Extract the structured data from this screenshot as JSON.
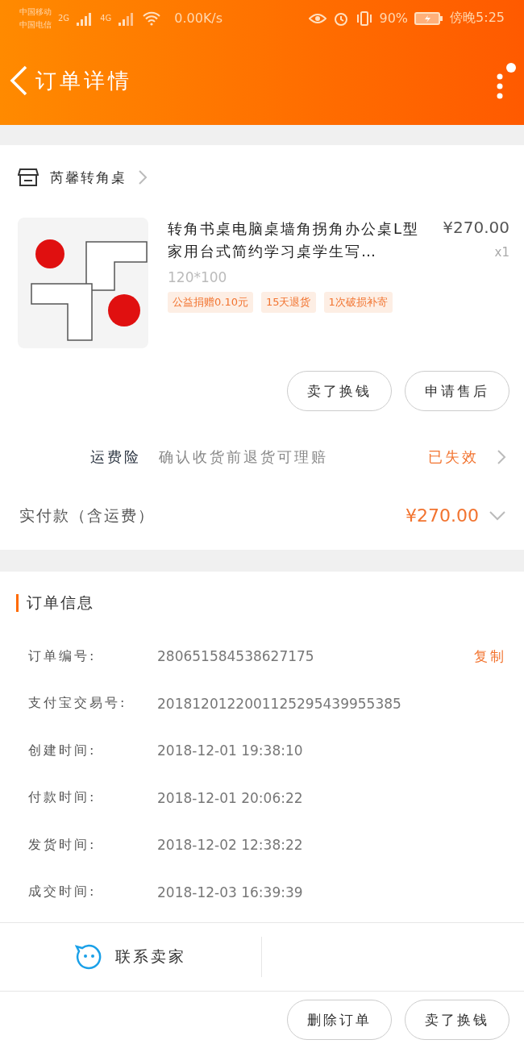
{
  "status_bar": {
    "carriers": [
      "中国移动",
      "中国电信"
    ],
    "networks": [
      "2G",
      "4G"
    ],
    "speed": "0.00K/s",
    "battery": "90%",
    "time": "傍晚5:25"
  },
  "header": {
    "title": "订单详情"
  },
  "shop": {
    "name": "芮馨转角桌"
  },
  "item": {
    "image": {
      "kind": "picture"
    },
    "title": "转角书桌电脑桌墙角拐角办公桌L型家用台式简约学习桌学生写…",
    "price": "¥270.00",
    "quantity": "x1",
    "spec": "120*100",
    "tags": [
      "公益捐赠0.10元",
      "15天退货",
      "1次破损补寄"
    ],
    "actions": [
      "卖了换钱",
      "申请售后"
    ]
  },
  "insurance": {
    "label": "运费险",
    "description": "确认收货前退货可理赔",
    "status": "已失效"
  },
  "total": {
    "label": "实付款（含运费）",
    "amount": "¥270.00",
    "expanded": false
  },
  "order_info": {
    "title": "订单信息",
    "copy": "复制",
    "rows": [
      {
        "label": "订单编号:",
        "value": "280651584538627175"
      },
      {
        "label": "支付宝交易号:",
        "value": "2018120122001125295439955385"
      },
      {
        "label": "创建时间:",
        "value": "2018-12-01 19:38:10"
      },
      {
        "label": "付款时间:",
        "value": "2018-12-01 20:06:22"
      },
      {
        "label": "发货时间:",
        "value": "2018-12-02 12:38:22"
      },
      {
        "label": "成交时间:",
        "value": "2018-12-03 16:39:39"
      }
    ]
  },
  "contact": {
    "label": "联系卖家"
  },
  "bottom_actions": [
    "删除订单",
    "卖了换钱"
  ]
}
